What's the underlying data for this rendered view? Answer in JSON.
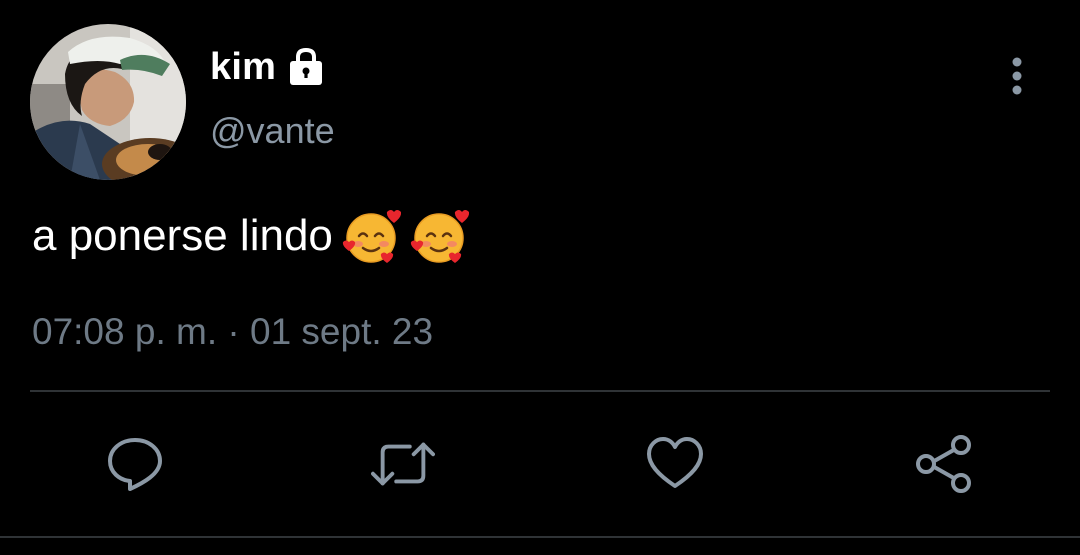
{
  "tweet": {
    "display_name": "kim",
    "handle": "@vante",
    "text": "a ponerse lindo",
    "emojis": [
      "smiling-face-with-hearts",
      "smiling-face-with-hearts"
    ],
    "time": "07:08 p. m.",
    "separator": "·",
    "date": "01 sept. 23",
    "protected": true
  },
  "actions": [
    {
      "name": "reply",
      "icon": "reply-icon"
    },
    {
      "name": "retweet",
      "icon": "retweet-icon"
    },
    {
      "name": "like",
      "icon": "heart-icon"
    },
    {
      "name": "share",
      "icon": "share-icon"
    }
  ],
  "colors": {
    "background": "#000000",
    "text": "#ffffff",
    "secondary": "#8b98a5",
    "icon": "#8b98a5",
    "divider": "#2f3336"
  }
}
